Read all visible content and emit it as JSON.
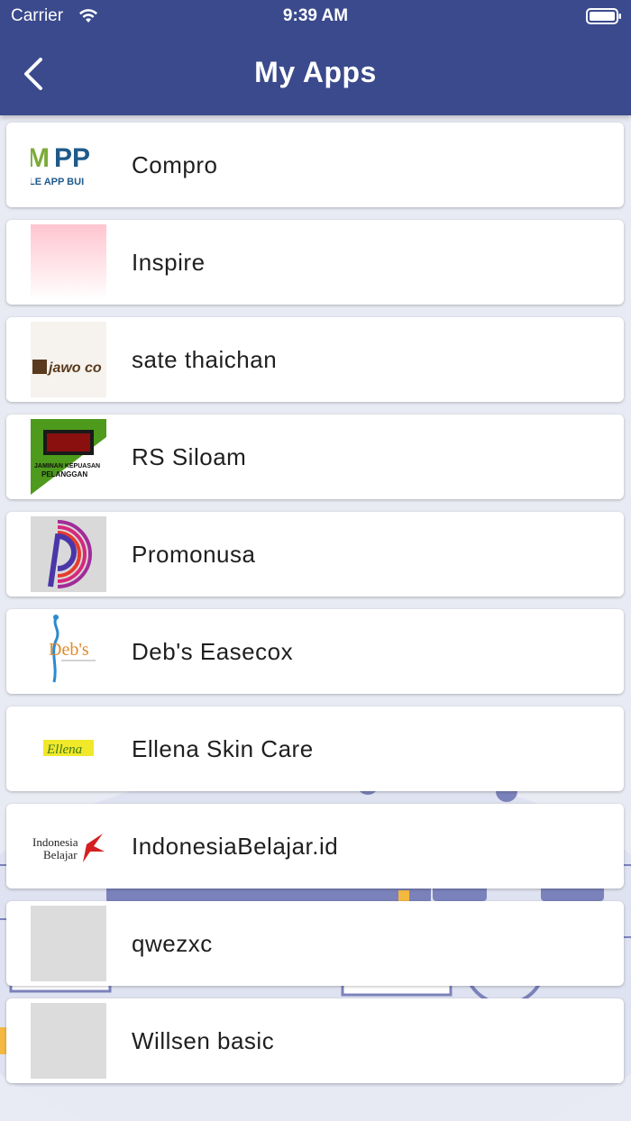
{
  "status_bar": {
    "carrier": "Carrier",
    "time": "9:39 AM"
  },
  "header": {
    "title": "My Apps",
    "back_icon": "chevron-left-icon"
  },
  "colors": {
    "header_bg": "#3a4a8c",
    "card_bg": "#ffffff",
    "page_bg": "#e9ebf4",
    "placeholder": "#dcdcdc"
  },
  "apps": [
    {
      "name": "Compro",
      "logo_text": "MPP",
      "logo_subtext": "LE APP BUI"
    },
    {
      "name": "Inspire"
    },
    {
      "name": "sate thaichan",
      "logo_text": "Sjawo co"
    },
    {
      "name": "RS Siloam",
      "logo_text": "JAMINAN KEPUASAN",
      "logo_subtext": "PELANGGAN"
    },
    {
      "name": "Promonusa"
    },
    {
      "name": "Deb's Easecox",
      "logo_text": "Deb's"
    },
    {
      "name": "Ellena Skin Care",
      "logo_text": "Ellena"
    },
    {
      "name": "IndonesiaBelajar.id",
      "logo_text": "Indonesia",
      "logo_subtext": "Belajar"
    },
    {
      "name": "qwezxc"
    },
    {
      "name": "Willsen basic"
    }
  ]
}
